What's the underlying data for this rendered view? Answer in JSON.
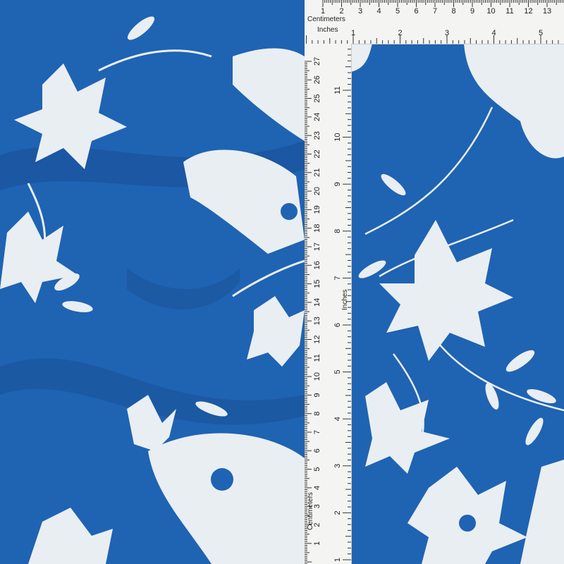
{
  "scene": {
    "fabric_color": "#1f63b3",
    "print_color": "#e9eef2",
    "ruler_color": "#f4f4f2"
  },
  "ruler": {
    "top_cm_label": "Centimeters",
    "top_in_label": "Inches",
    "side_cm_label": "Centimeters",
    "side_in_label": "Inches",
    "top_cm_ticks": [
      "1",
      "2",
      "3",
      "4",
      "5",
      "6",
      "7",
      "8",
      "9",
      "10",
      "11",
      "12",
      "13",
      "1"
    ],
    "top_in_ticks": [
      "1",
      "2",
      "3",
      "4",
      "5"
    ],
    "side_cm_ticks": [
      "27",
      "26",
      "25",
      "24",
      "23",
      "22",
      "21",
      "20",
      "19",
      "18",
      "17",
      "16",
      "15",
      "14",
      "13",
      "12",
      "11",
      "10",
      "9",
      "8",
      "7",
      "6",
      "5",
      "4",
      "3",
      "2",
      "1"
    ],
    "side_in_ticks": [
      "11",
      "10",
      "9",
      "8",
      "7",
      "6",
      "5",
      "4",
      "3",
      "2",
      "1"
    ]
  }
}
